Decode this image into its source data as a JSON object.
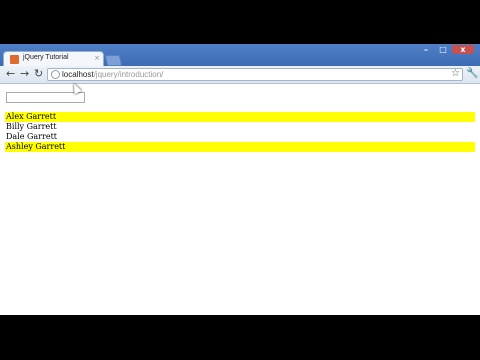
{
  "browser": {
    "tab_title": "jQuery Tutorial",
    "tab_close": "×",
    "url_host": "localhost",
    "url_path": "/jquery/introduction/",
    "back": "←",
    "forward": "→",
    "reload": "↻",
    "star": "☆",
    "wrench": "🔧",
    "window_controls": {
      "minimize": "–",
      "maximize": "□",
      "close": "x"
    }
  },
  "page": {
    "search_value": "",
    "names": [
      {
        "text": "Alex Garrett",
        "highlighted": true
      },
      {
        "text": "Billy Garrett",
        "highlighted": false
      },
      {
        "text": "Dale Garrett",
        "highlighted": false
      },
      {
        "text": "Ashley Garrett",
        "highlighted": true
      }
    ]
  },
  "colors": {
    "highlight": "#ffff00",
    "titlebar": "#4f7fc7"
  }
}
